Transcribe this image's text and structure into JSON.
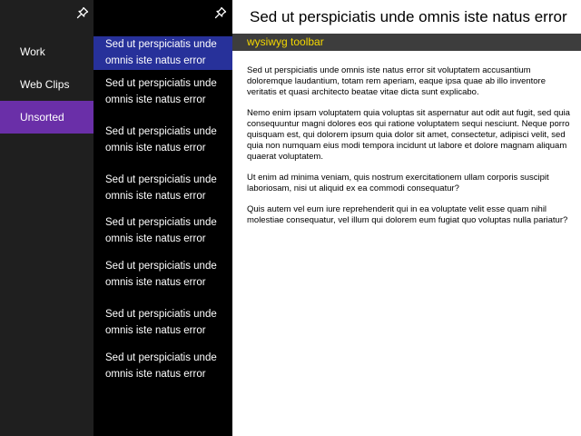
{
  "nav": {
    "items": [
      {
        "label": "Work"
      },
      {
        "label": "Web Clips"
      },
      {
        "label": "Unsorted"
      }
    ],
    "active_index": 2,
    "pin_icon": "pin-icon",
    "accent_color": "#6a2fa8"
  },
  "list": {
    "items": [
      {
        "label": "Sed ut perspiciatis unde omnis iste natus error"
      },
      {
        "label": "Sed ut perspiciatis unde omnis iste natus error"
      },
      {
        "label": "Sed ut perspiciatis unde omnis iste natus error"
      },
      {
        "label": "Sed ut perspiciatis unde omnis iste natus error"
      },
      {
        "label": "Sed ut perspiciatis unde omnis iste natus error"
      },
      {
        "label": "Sed ut perspiciatis unde omnis iste natus error"
      },
      {
        "label": "Sed ut perspiciatis unde omnis iste natus error"
      },
      {
        "label": "Sed ut perspiciatis unde omnis iste natus error"
      }
    ],
    "selected_index": 0,
    "pin_icon": "pin-icon",
    "selection_color": "#27319a"
  },
  "content": {
    "title": "Sed ut perspiciatis unde omnis iste natus error",
    "toolbar_label": "wysiwyg toolbar",
    "toolbar_text_color": "#f5d800",
    "paragraphs": [
      "Sed ut perspiciatis unde omnis iste natus error sit voluptatem accusantium doloremque laudantium, totam rem aperiam, eaque ipsa quae ab illo inventore veritatis et quasi architecto beatae vitae dicta sunt explicabo.",
      "Nemo enim ipsam voluptatem quia voluptas sit aspernatur aut odit aut fugit, sed quia consequuntur magni dolores eos qui ratione voluptatem sequi nesciunt. Neque porro quisquam est, qui dolorem ipsum quia dolor sit amet, consectetur, adipisci velit, sed quia non numquam eius modi tempora incidunt ut labore et dolore magnam aliquam quaerat voluptatem.",
      "Ut enim ad minima veniam, quis nostrum exercitationem ullam corporis suscipit laboriosam, nisi ut aliquid ex ea commodi consequatur?",
      "Quis autem vel eum iure reprehenderit qui in ea voluptate velit esse quam nihil molestiae consequatur, vel illum qui dolorem eum fugiat quo voluptas nulla pariatur?"
    ]
  }
}
